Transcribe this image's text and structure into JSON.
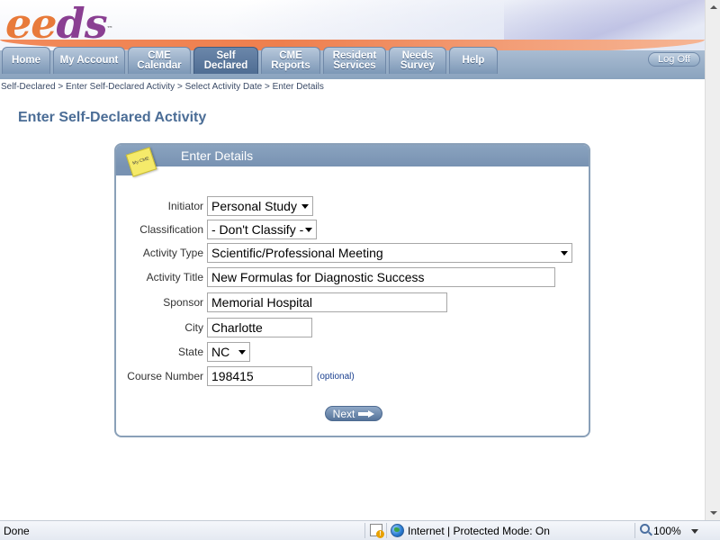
{
  "header": {
    "logo_text_part1": "ee",
    "logo_text_part2": "ds",
    "logo_trademark": "™",
    "logoff_label": "Log Off"
  },
  "tabs": [
    {
      "label": "Home"
    },
    {
      "label": "My Account"
    },
    {
      "label": "CME\nCalendar"
    },
    {
      "label": "Self\nDeclared",
      "active": true
    },
    {
      "label": "CME\nReports"
    },
    {
      "label": "Resident\nServices"
    },
    {
      "label": "Needs\nSurvey"
    },
    {
      "label": "Help"
    }
  ],
  "breadcrumb": {
    "items": [
      "Self-Declared",
      "Enter Self-Declared Activity",
      "Select Activity Date",
      "Enter Details"
    ],
    "separator": " > "
  },
  "page": {
    "title": "Enter Self-Declared Activity"
  },
  "panel": {
    "title": "Enter Details",
    "sticky_label": "My CME"
  },
  "form": {
    "initiator": {
      "label": "Initiator",
      "value": "Personal Study"
    },
    "classification": {
      "label": "Classification",
      "value": "- Don't Classify -"
    },
    "activity_type": {
      "label": "Activity Type",
      "value": "Scientific/Professional Meeting"
    },
    "activity_title": {
      "label": "Activity Title",
      "value": "New Formulas for Diagnostic Success"
    },
    "sponsor": {
      "label": "Sponsor",
      "value": "Memorial Hospital"
    },
    "city": {
      "label": "City",
      "value": "Charlotte"
    },
    "state": {
      "label": "State",
      "value": "NC"
    },
    "course_number": {
      "label": "Course Number",
      "value": "198415",
      "hint": "(optional)"
    },
    "next_label": "Next"
  },
  "statusbar": {
    "status": "Done",
    "zone": "Internet | Protected Mode: On",
    "zoom": "100%"
  },
  "colors": {
    "accent": "#4b6d96",
    "tab_bg": "#8aa3be",
    "orange": "#ee7f4e",
    "purple": "#8a3f92"
  }
}
